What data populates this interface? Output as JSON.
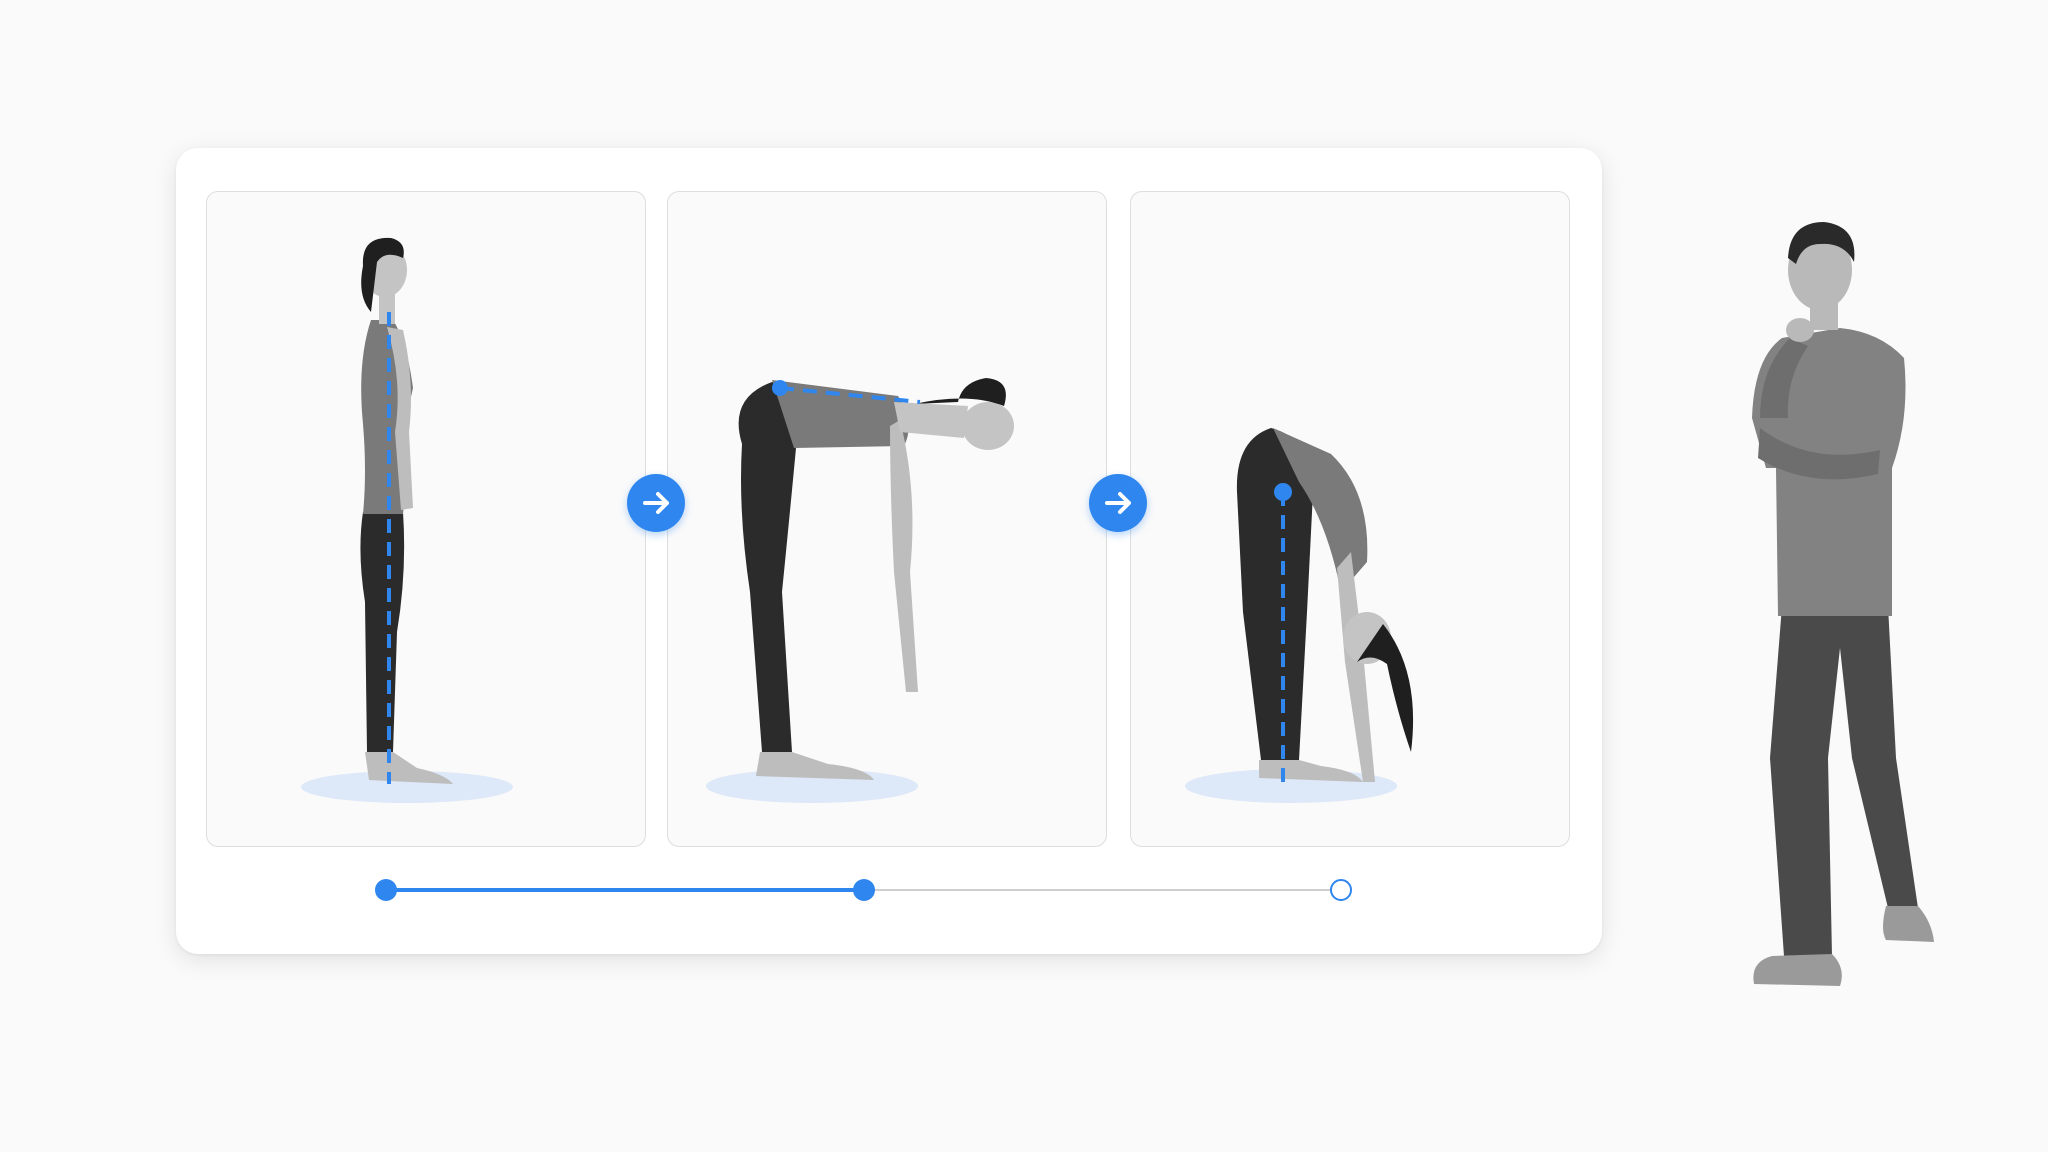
{
  "steps": [
    {
      "name": "standing"
    },
    {
      "name": "half-fold"
    },
    {
      "name": "forward-fold"
    }
  ],
  "progress": {
    "total_steps": 3,
    "completed_steps": 2
  },
  "colors": {
    "accent": "#2f86ee",
    "floor_shadow": "#dde8f8",
    "track_inactive": "#cfcfcf"
  },
  "icons": {
    "next": "arrow-right-icon"
  }
}
